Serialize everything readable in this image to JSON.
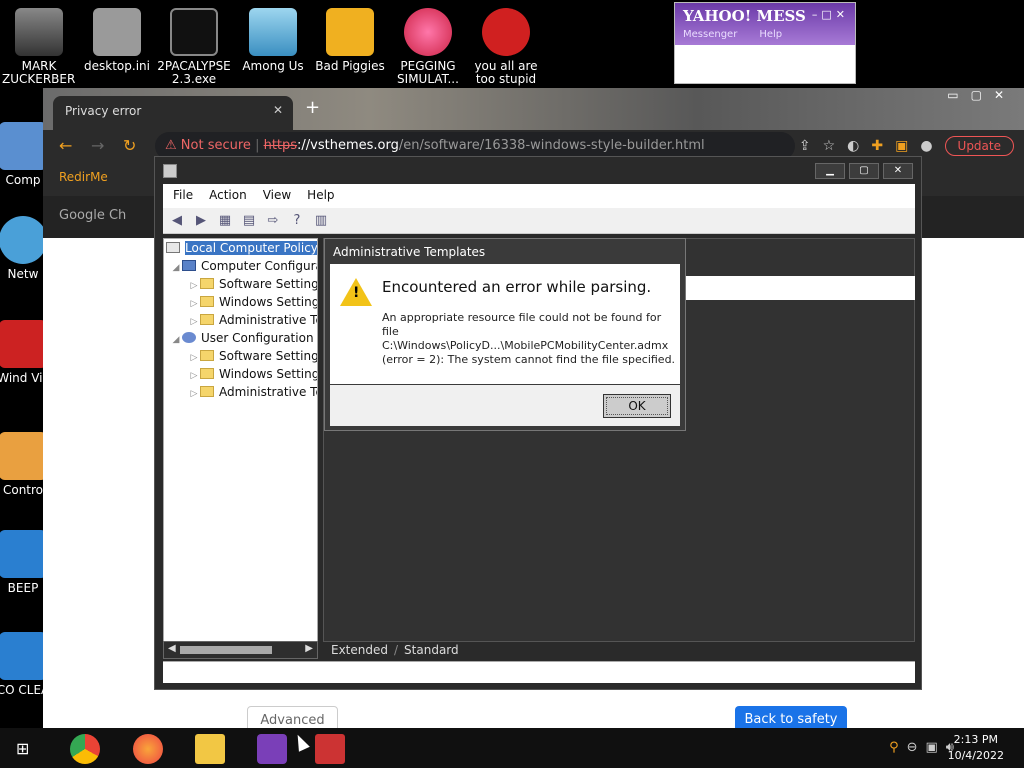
{
  "desktop": {
    "icons_top": [
      {
        "label": "MARK ZUCKERBERG",
        "icon": "person-image-icon"
      },
      {
        "label": "desktop.ini",
        "icon": "settings-file-icon"
      },
      {
        "label": "2PACALYPSE 2.3.exe",
        "icon": "console-app-icon"
      },
      {
        "label": "Among Us",
        "icon": "game-icon"
      },
      {
        "label": "Bad Piggies",
        "icon": "game-icon"
      },
      {
        "label": "PEGGING SIMULAT...",
        "icon": "game-icon"
      },
      {
        "label": "you all are too stupid ...",
        "icon": "dev-cpp-icon"
      }
    ],
    "icons_left": [
      {
        "label": "Comp",
        "icon": "computer-icon"
      },
      {
        "label": "Netw",
        "icon": "network-icon"
      },
      {
        "label": "Wind Vis",
        "icon": "app-icon"
      },
      {
        "label": "Contro",
        "icon": "control-panel-icon"
      },
      {
        "label": "BEEP",
        "icon": "shortcut-icon"
      },
      {
        "label": "CO CLEA",
        "icon": "shortcut-icon"
      }
    ]
  },
  "yahoo": {
    "brand": "YAHOO! MESS",
    "links": [
      "Messenger",
      "Help"
    ],
    "controls": "–□✕"
  },
  "browser": {
    "tab_title": "Privacy error",
    "warning": "Not secure",
    "url_scheme": "https",
    "url_host": "://vsthemes.org",
    "url_path": "/en/software/16338-windows-style-builder.html",
    "update_label": "Update",
    "bookmark": "RedirMe",
    "page_tab": "Google Ch",
    "advanced_label": "Advanced",
    "back_label": "Back to safety"
  },
  "gpedit": {
    "menu": [
      "File",
      "Action",
      "View",
      "Help"
    ],
    "tree": [
      {
        "label": "Local Computer Policy",
        "level": 0,
        "icon": "book",
        "selected": true
      },
      {
        "label": "Computer Configura",
        "level": 1,
        "icon": "comp"
      },
      {
        "label": "Software Settings",
        "level": 2,
        "icon": "folder"
      },
      {
        "label": "Windows Setting",
        "level": 2,
        "icon": "folder"
      },
      {
        "label": "Administrative Te",
        "level": 2,
        "icon": "folder"
      },
      {
        "label": "User Configuration",
        "level": 1,
        "icon": "user"
      },
      {
        "label": "Software Settings",
        "level": 2,
        "icon": "folder"
      },
      {
        "label": "Windows Setting",
        "level": 2,
        "icon": "folder"
      },
      {
        "label": "Administrative Te",
        "level": 2,
        "icon": "folder"
      }
    ],
    "view_tabs": [
      "Extended",
      "Standard"
    ]
  },
  "dialog": {
    "title": "Administrative Templates",
    "heading": "Encountered an error while parsing.",
    "message_line1": "An appropriate resource file could not be found for file",
    "message_line2": "C:\\Windows\\PolicyD...\\MobilePCMobilityCenter.admx",
    "message_line3": "(error = 2): The system cannot find the file specified.",
    "ok_label": "OK"
  },
  "taskbar": {
    "time": "2:13 PM",
    "date": "10/4/2022"
  },
  "colors": {
    "warning": "#f2c318",
    "selection": "#3a75c4",
    "accent": "#f0a020"
  }
}
